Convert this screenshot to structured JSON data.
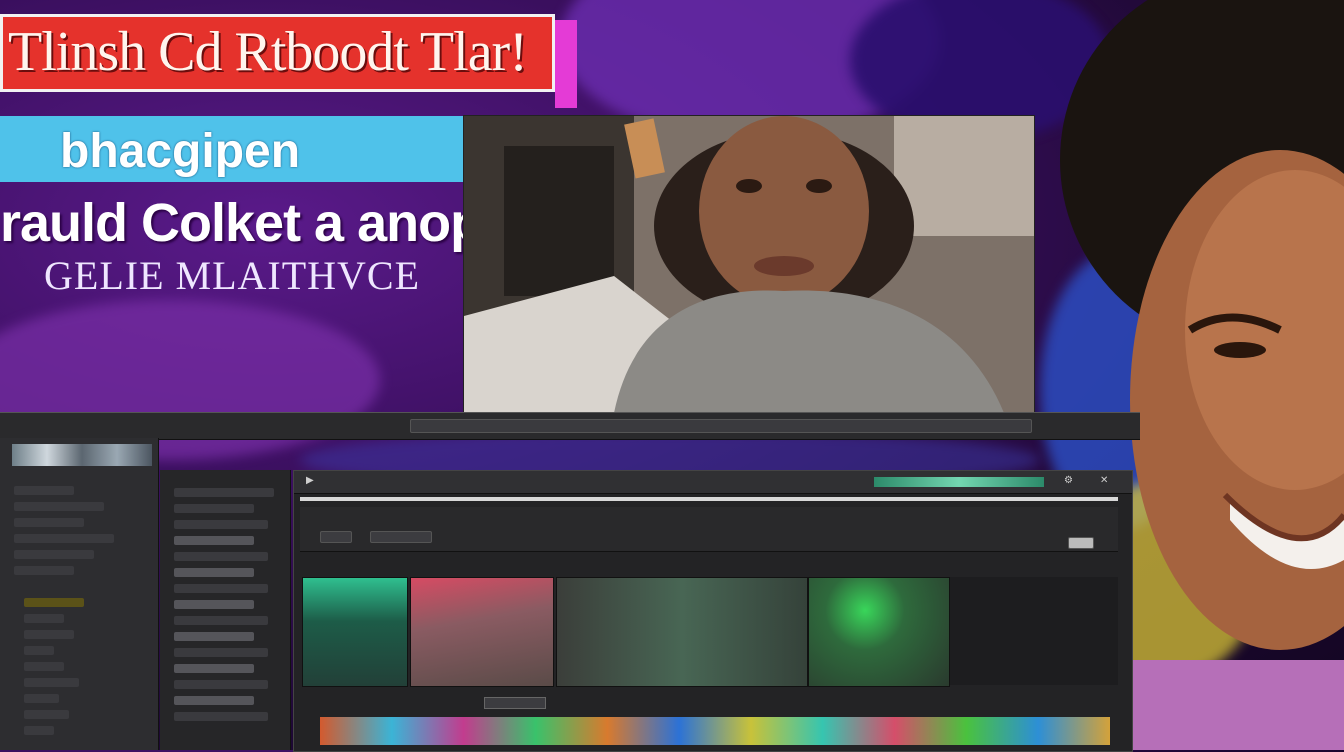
{
  "banner": {
    "title": "Tlinsh Cd Rtboodt Tlar!",
    "subtitle": "bhacgipen",
    "headline": "rauld Colket a anopous",
    "tagline": "GELIE MLAITHVCE"
  },
  "colors": {
    "title_banner": "#e5322c",
    "sub_banner": "#4fc2ea",
    "background": "#3a0f5e",
    "editor_panel": "#2d2d30",
    "timeline": "#232325"
  },
  "editor": {
    "timeline_toolbar": {
      "play_icon": "play-icon",
      "settings_icon": "gear-icon",
      "close_icon": "close-icon"
    },
    "clip_icons": [
      "clip-thumbnail",
      "clip-thumbnail",
      "clip-thumbnail",
      "clip-thumbnail"
    ]
  }
}
